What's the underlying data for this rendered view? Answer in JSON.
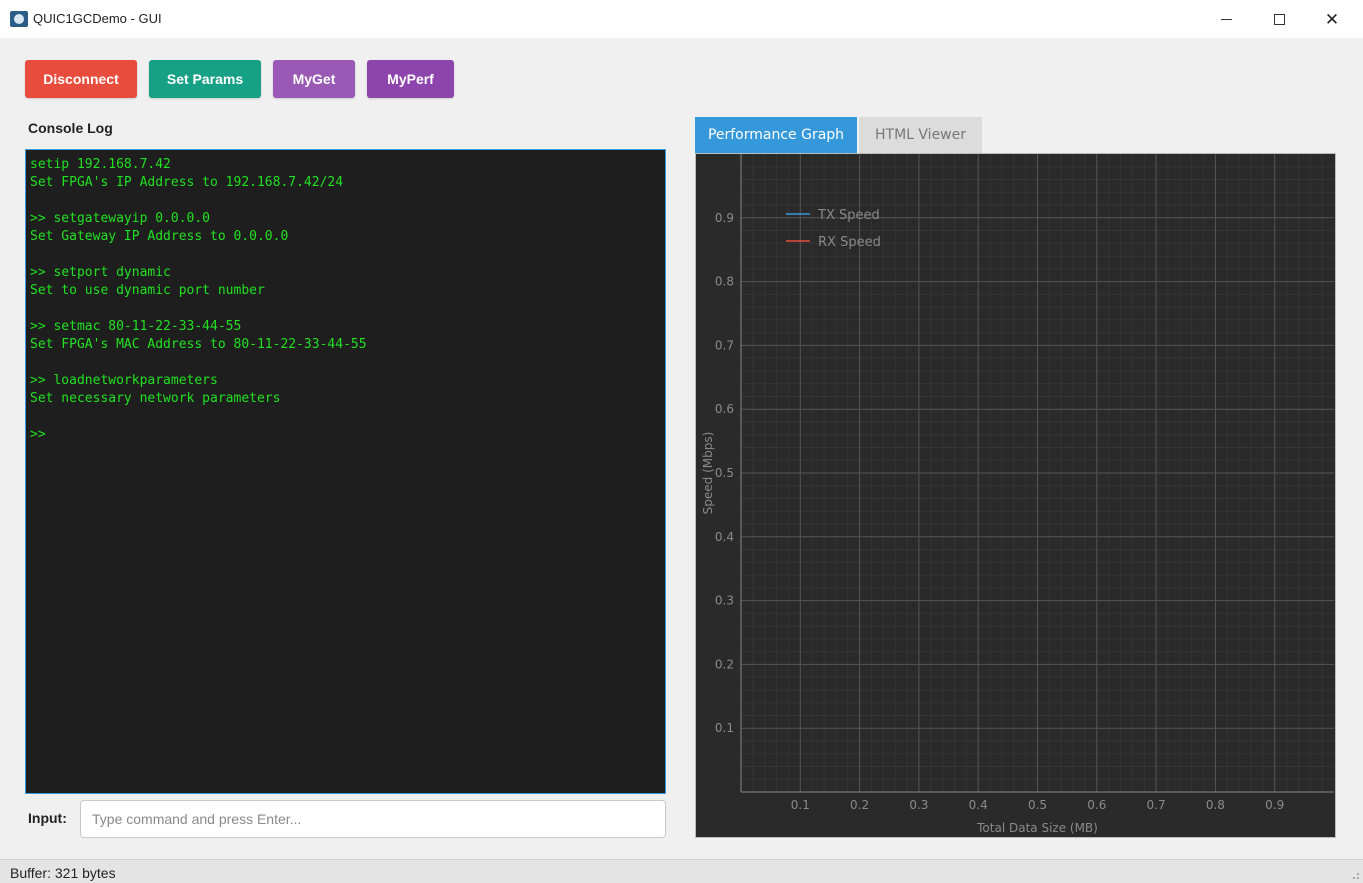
{
  "window": {
    "title": "QUIC1GCDemo - GUI",
    "minimize_glyph": "—",
    "close_glyph": "✕"
  },
  "toolbar": {
    "disconnect_label": "Disconnect",
    "set_params_label": "Set Params",
    "myget_label": "MyGet",
    "myperf_label": "MyPerf"
  },
  "console": {
    "label": "Console Log",
    "lines": [
      "setip 192.168.7.42",
      "Set FPGA's IP Address to 192.168.7.42/24",
      "",
      ">> setgatewayip 0.0.0.0",
      "Set Gateway IP Address to 0.0.0.0",
      "",
      ">> setport dynamic",
      "Set to use dynamic port number",
      "",
      ">> setmac 80-11-22-33-44-55",
      "Set FPGA's MAC Address to 80-11-22-33-44-55",
      "",
      ">> loadnetworkparameters",
      "Set necessary network parameters",
      "",
      ">>"
    ]
  },
  "input": {
    "label": "Input:",
    "placeholder": "Type command and press Enter...",
    "value": ""
  },
  "tabs": {
    "performance_graph": "Performance Graph",
    "html_viewer": "HTML Viewer"
  },
  "chart_data": {
    "type": "line",
    "xlabel": "Total Data Size (MB)",
    "ylabel": "Speed (Mbps)",
    "xlim": [
      0,
      1.0
    ],
    "ylim": [
      0,
      1.0
    ],
    "xticks": [
      "0.1",
      "0.2",
      "0.3",
      "0.4",
      "0.5",
      "0.6",
      "0.7",
      "0.8",
      "0.9"
    ],
    "yticks": [
      "0.1",
      "0.2",
      "0.3",
      "0.4",
      "0.5",
      "0.6",
      "0.7",
      "0.8",
      "0.9"
    ],
    "grid": true,
    "legend_position": "top-left",
    "series": [
      {
        "name": "TX Speed",
        "color": "#3498db",
        "x": [],
        "y": []
      },
      {
        "name": "RX Speed",
        "color": "#e74c3c",
        "x": [],
        "y": []
      }
    ]
  },
  "status": {
    "buffer_text": "Buffer: 321 bytes"
  }
}
